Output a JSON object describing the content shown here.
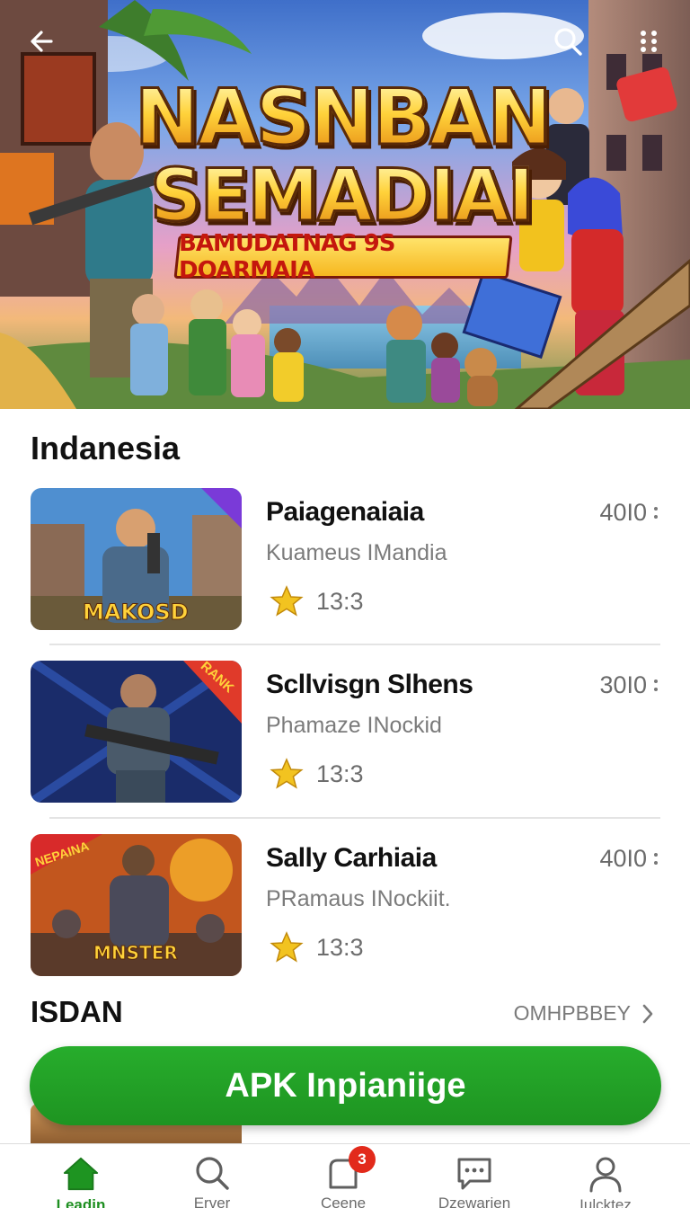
{
  "hero": {
    "title_line1": "NASNBAN",
    "title_line2": "SEMADIAI",
    "ribbon": "BAMUDATNAG 9S DOARMAIA",
    "back_icon": "arrow-left-icon",
    "search_icon": "search-icon",
    "more_icon": "dots-grid-icon"
  },
  "section": {
    "title": "Indanesia",
    "apps": [
      {
        "name": "Paiagenaiaia",
        "developer": "Kuameus IMandia",
        "rating": "13:3",
        "size": "40I0",
        "thumb_text": "MAKOSD",
        "thumb_badge": ""
      },
      {
        "name": "Scllvisgn Slhens",
        "developer": "Phamaze INockid",
        "rating": "13:3",
        "size": "30I0",
        "thumb_text": "",
        "thumb_badge": "RANK"
      },
      {
        "name": "Sally Carhiaia",
        "developer": "PRamaus INockiit.",
        "rating": "13:3",
        "size": "40I0",
        "thumb_text": "MNSTER",
        "thumb_badge": "NEPAINA"
      }
    ]
  },
  "section2": {
    "title": "ISDAN",
    "see_more": "OMHPBBEY"
  },
  "install_button": {
    "label": "APK Inpianiige"
  },
  "nav": {
    "items": [
      {
        "label": "Leadin",
        "icon": "home-icon"
      },
      {
        "label": "Erver",
        "icon": "search-icon"
      },
      {
        "label": "Ceene",
        "icon": "notification-bag-icon",
        "badge": "3"
      },
      {
        "label": "Dzewarien",
        "icon": "chat-icon"
      },
      {
        "label": "Iulcktez",
        "icon": "profile-icon"
      }
    ]
  },
  "colors": {
    "accent_green": "#1e9421",
    "badge_red": "#e22a1b",
    "star_gold": "#f2b81a"
  }
}
